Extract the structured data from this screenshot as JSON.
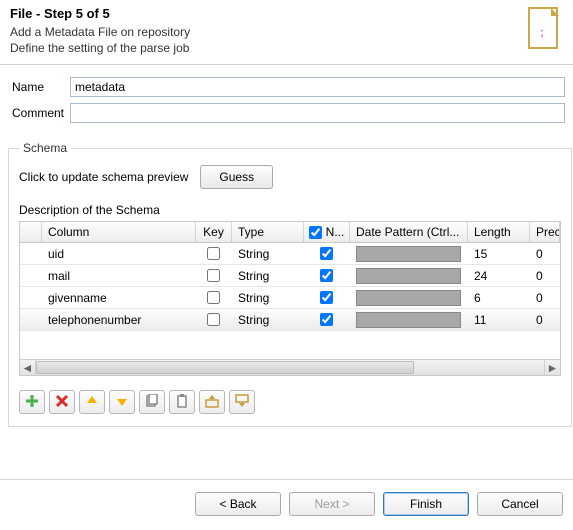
{
  "header": {
    "title": "File - Step 5 of 5",
    "sub1": "Add a Metadata File on repository",
    "sub2": "Define the setting of the parse job"
  },
  "form": {
    "name_label": "Name",
    "name_value": "metadata",
    "comment_label": "Comment",
    "comment_value": ""
  },
  "schema": {
    "legend": "Schema",
    "guess_hint": "Click to update schema preview",
    "guess_btn": "Guess",
    "desc_label": "Description of the Schema",
    "headers": {
      "column": "Column",
      "key": "Key",
      "type": "Type",
      "n": "N...",
      "date": "Date Pattern (Ctrl...",
      "length": "Length",
      "prec": "Prec"
    },
    "rows": [
      {
        "column": "uid",
        "key": false,
        "type": "String",
        "n": true,
        "length": "15",
        "prec": "0",
        "selected": false
      },
      {
        "column": "mail",
        "key": false,
        "type": "String",
        "n": true,
        "length": "24",
        "prec": "0",
        "selected": false
      },
      {
        "column": "givenname",
        "key": false,
        "type": "String",
        "n": true,
        "length": "6",
        "prec": "0",
        "selected": false
      },
      {
        "column": "telephonenumber",
        "key": false,
        "type": "String",
        "n": true,
        "length": "11",
        "prec": "0",
        "selected": true
      }
    ]
  },
  "toolbar_icons": [
    "add",
    "delete",
    "move-up",
    "move-down",
    "copy",
    "paste",
    "import",
    "export"
  ],
  "footer": {
    "back": "< Back",
    "next": "Next >",
    "finish": "Finish",
    "cancel": "Cancel"
  }
}
